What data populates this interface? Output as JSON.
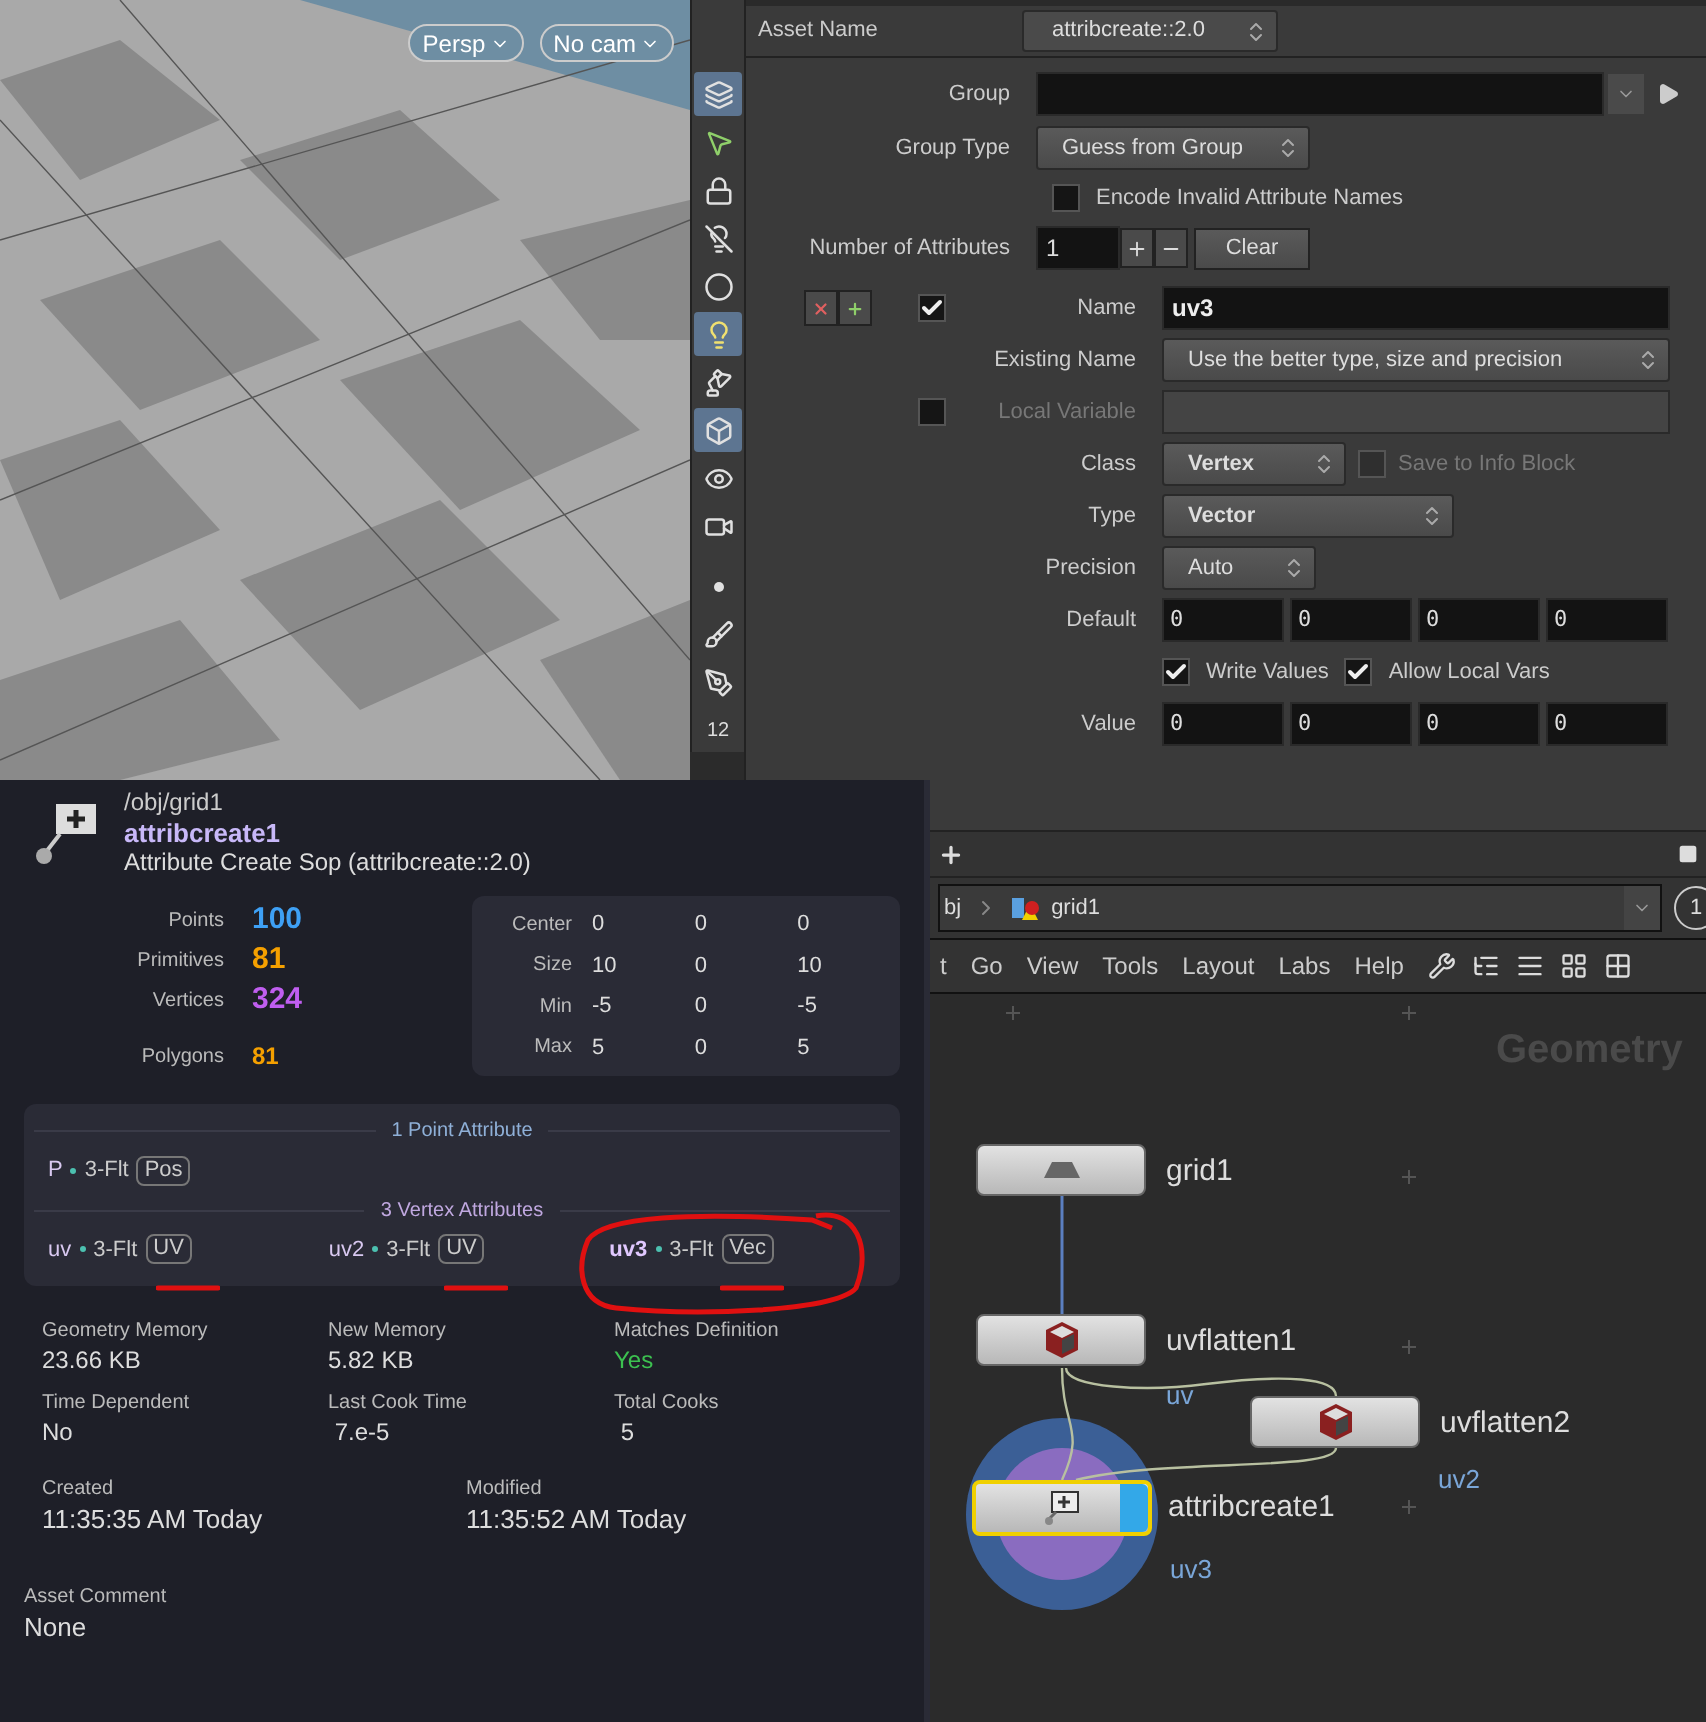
{
  "viewport": {
    "view_menus": [
      "Persp",
      "No cam"
    ],
    "toolbar": [
      {
        "kind": "layers",
        "selected": true
      },
      {
        "kind": "select",
        "selected": false
      },
      {
        "kind": "lock",
        "selected": false
      },
      {
        "kind": "bulb-off",
        "selected": false
      },
      {
        "kind": "sphere",
        "selected": false
      },
      {
        "kind": "bulb",
        "selected": true
      },
      {
        "kind": "lamp",
        "selected": false
      },
      {
        "kind": "cube",
        "selected": true
      },
      {
        "kind": "eye",
        "selected": false
      },
      {
        "kind": "camera",
        "selected": false
      },
      {
        "kind": "dot",
        "selected": false
      },
      {
        "kind": "brush",
        "selected": false
      },
      {
        "kind": "pen",
        "selected": false
      },
      {
        "kind": "numbers",
        "badge": "12",
        "selected": false
      }
    ]
  },
  "parameters": {
    "asset_name_label": "Asset Name",
    "asset_name": "attribcreate::2.0",
    "rows": [
      {
        "kind": "field",
        "label": "Group"
      },
      {
        "kind": "menu",
        "label": "Group Type",
        "value": "Guess from Group"
      },
      {
        "kind": "checkbox",
        "label": "Encode Invalid Attribute Names",
        "checked": false
      },
      {
        "kind": "counter",
        "label": "Number of Attributes",
        "value": "1",
        "button": "Clear"
      }
    ],
    "attribute_rows": [
      {
        "kind": "field",
        "label": "Name",
        "value": "uv3",
        "toggle": true,
        "disabled": false
      },
      {
        "kind": "menu",
        "label": "Existing Name",
        "value": "Use the better type, size and precision",
        "disabled": false
      },
      {
        "kind": "field",
        "label": "Local Variable",
        "toggle": false,
        "disabled": true
      },
      {
        "kind": "menu",
        "label": "Class",
        "value": "Vertex",
        "bold": true,
        "disabled": false,
        "extra": {
          "label": "Save to Info Block",
          "checked": false,
          "disabled": true
        }
      },
      {
        "kind": "menu",
        "label": "Type",
        "value": "Vector",
        "bold": true,
        "disabled": false
      },
      {
        "kind": "menu",
        "label": "Precision",
        "value": "Auto",
        "disabled": false
      },
      {
        "kind": "tuple",
        "label": "Default",
        "values": [
          "0",
          "0",
          "0",
          "0"
        ],
        "disabled": false
      },
      {
        "kind": "checks",
        "items": [
          {
            "label": "Write Values",
            "checked": true
          },
          {
            "label": "Allow Local Vars",
            "checked": true
          }
        ]
      },
      {
        "kind": "tuple",
        "label": "Value",
        "values": [
          "0",
          "0",
          "0",
          "0"
        ],
        "disabled": false
      }
    ]
  },
  "info": {
    "path": "/obj/grid1",
    "name": "attribcreate1",
    "type": "Attribute Create Sop (attribcreate::2.0)",
    "stats": [
      {
        "label": "Points",
        "value": "100",
        "color": "#3ea0f5"
      },
      {
        "label": "Primitives",
        "value": "81",
        "color": "#f5a000"
      },
      {
        "label": "Vertices",
        "value": "324",
        "color": "#c05ef0"
      },
      {
        "label": "Polygons",
        "value": "81",
        "color": "#f5a000"
      }
    ],
    "bounds": [
      {
        "label": "Center",
        "values": [
          "0",
          "0",
          "0"
        ]
      },
      {
        "label": "Size",
        "values": [
          "10",
          "0",
          "10"
        ]
      },
      {
        "label": "Min",
        "values": [
          "-5",
          "0",
          "-5"
        ]
      },
      {
        "label": "Max",
        "values": [
          "5",
          "0",
          "5"
        ]
      }
    ],
    "attribute_groups": [
      {
        "title": "1 Point Attribute",
        "items": [
          {
            "name": "P",
            "type": "3-Flt",
            "tag": "Pos",
            "highlighted": false
          }
        ]
      },
      {
        "title": "3 Vertex Attributes",
        "items": [
          {
            "name": "uv",
            "type": "3-Flt",
            "tag": "UV",
            "highlighted": false
          },
          {
            "name": "uv2",
            "type": "3-Flt",
            "tag": "UV",
            "highlighted": false
          },
          {
            "name": "uv3",
            "type": "3-Flt",
            "tag": "Vec",
            "highlighted": true
          }
        ]
      }
    ],
    "details": [
      {
        "label": "Geometry Memory",
        "value": "23.66 KB"
      },
      {
        "label": "New Memory",
        "value": "5.82 KB"
      },
      {
        "label": "Matches Definition",
        "value": "Yes",
        "kind": "ok"
      },
      {
        "label": "Time Dependent",
        "value": "No"
      },
      {
        "label": "Last Cook Time",
        "value": " 7.e-5"
      },
      {
        "label": "Total Cooks",
        "value": " 5"
      }
    ],
    "times": [
      {
        "label": "Created",
        "value": "11:35:35 AM Today"
      },
      {
        "label": "Modified",
        "value": "11:35:52 AM Today"
      }
    ],
    "comment": {
      "label": "Asset Comment",
      "value": "None"
    }
  },
  "network": {
    "path": [
      "bj",
      "grid1"
    ],
    "pin": "1",
    "menu": [
      "t",
      "Go",
      "View",
      "Tools",
      "Layout",
      "Labs",
      "Help"
    ],
    "context": "Geometry",
    "nodes": [
      {
        "name": "grid1",
        "kind": "grid",
        "selected": false
      },
      {
        "name": "uvflatten1",
        "kind": "flatten",
        "selected": false,
        "output": "uv"
      },
      {
        "name": "uvflatten2",
        "kind": "flatten",
        "selected": false,
        "output": "uv2"
      },
      {
        "name": "attribcreate1",
        "kind": "create",
        "selected": true,
        "output": "uv3"
      }
    ]
  }
}
